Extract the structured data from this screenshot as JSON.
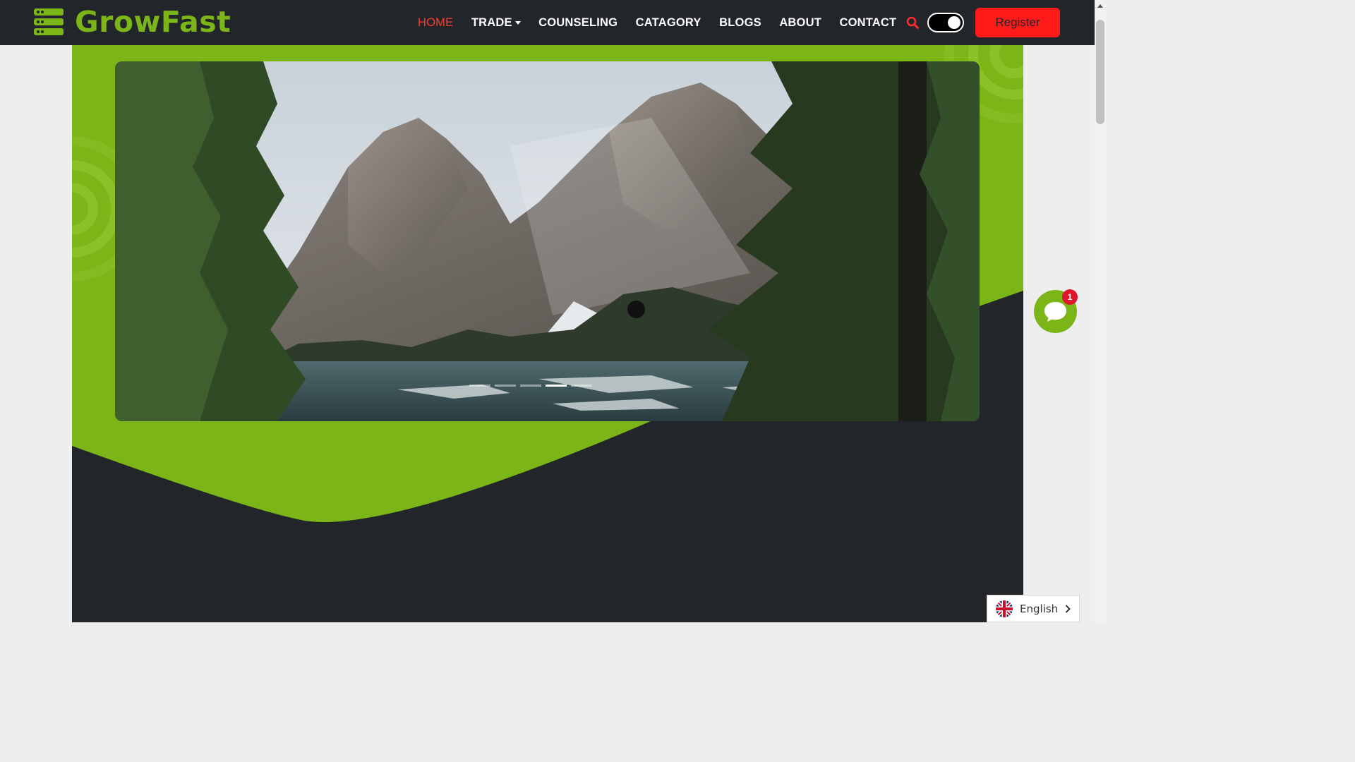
{
  "brand": {
    "name": "GrowFast",
    "logo_icon": "server-stack-icon"
  },
  "nav": {
    "items": [
      {
        "label": "HOME",
        "active": true
      },
      {
        "label": "TRADE",
        "has_dropdown": true
      },
      {
        "label": "COUNSELING"
      },
      {
        "label": "CATAGORY"
      },
      {
        "label": "BLOGS"
      },
      {
        "label": "ABOUT"
      },
      {
        "label": "CONTACT"
      }
    ],
    "search_icon": "search-icon",
    "theme_toggle": {
      "state": "on"
    },
    "register_label": "Register"
  },
  "hero": {
    "slide": {
      "subject": "mountain-lake-landscape"
    },
    "carousel": {
      "slide_count": 5,
      "active_index": 3
    }
  },
  "chat": {
    "icon": "chat-bubble-icon",
    "badge_count": "1"
  },
  "language": {
    "label": "English",
    "flag": "uk-flag-icon"
  },
  "colors": {
    "accent_green": "#7cb518",
    "dark": "#22252a",
    "register_red": "#ff1a1a",
    "active_nav": "#ff3b30",
    "badge_red": "#e0142b"
  }
}
